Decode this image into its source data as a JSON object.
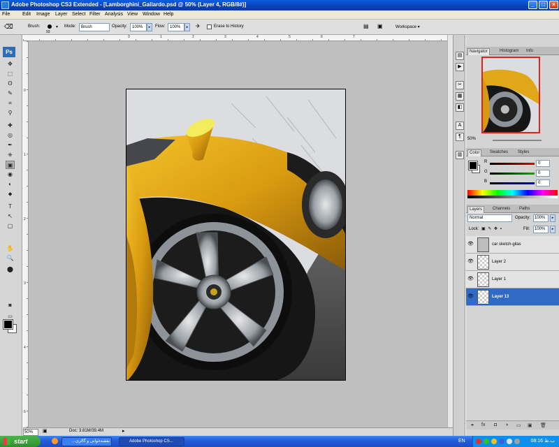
{
  "window": {
    "title": "Adobe Photoshop CS3 Extended - [Lamborghini_Gallardo.psd @ 50% (Layer 4, RGB/8#)]",
    "minimize": "_",
    "maximize": "□",
    "close": "×"
  },
  "menu": [
    "File",
    "Edit",
    "Image",
    "Layer",
    "Select",
    "Filter",
    "Analysis",
    "View",
    "Window",
    "Help"
  ],
  "options": {
    "brush_label": "Brush:",
    "brush_size": "93",
    "mode_label": "Mode:",
    "mode_value": "Brush",
    "opacity_label": "Opacity:",
    "opacity_value": "100%",
    "flow_label": "Flow:",
    "flow_value": "100%",
    "erase_history": "Erase to History",
    "workspace": "Workspace ▾"
  },
  "toolbox": {
    "logo": "Ps",
    "tools": [
      "✥",
      "⬚",
      "ʘ",
      "✎",
      "⌗",
      "⚲",
      "✚",
      "◎",
      "✒",
      "⎈",
      "▣",
      "◉",
      "◐",
      "⬥",
      "T",
      "↖",
      "▢",
      "✋",
      "🔍",
      "⬤"
    ]
  },
  "rulers": {
    "top": [
      "0",
      "1",
      "2",
      "3",
      "4",
      "5",
      "6",
      "7"
    ],
    "left": [
      "0",
      "1",
      "2",
      "3",
      "4",
      "5"
    ]
  },
  "status": {
    "zoom": "50%",
    "doc": "Doc: 3.81M/39.4M"
  },
  "navigator": {
    "tabs": [
      "Navigator",
      "Histogram",
      "Info"
    ],
    "zoom": "50%"
  },
  "color_panel": {
    "tabs": [
      "Color",
      "Swatches",
      "Styles"
    ],
    "channels": [
      {
        "label": "R",
        "value": "0",
        "color": "#e00000"
      },
      {
        "label": "G",
        "value": "0",
        "color": "#00b000"
      },
      {
        "label": "B",
        "value": "0",
        "color": "#0000e0"
      }
    ]
  },
  "layers_panel": {
    "tabs": [
      "Layers",
      "Channels",
      "Paths"
    ],
    "blend_mode": "Normal",
    "opacity_label": "Opacity:",
    "opacity_value": "100%",
    "lock_label": "Lock:",
    "lock_icons": "▣ ✎ ✥ ▪",
    "fill_label": "Fill:",
    "fill_value": "100%",
    "layers": [
      {
        "name": "car sketch-gilas",
        "selected": false
      },
      {
        "name": "Layer 2",
        "selected": false
      },
      {
        "name": "Layer 1",
        "selected": false
      },
      {
        "name": "Layer 13",
        "selected": true
      }
    ]
  },
  "taskbar": {
    "start": "start",
    "tasks": [
      {
        "label": "...نقشه‌خوانی و گالری - ",
        "active": false
      },
      {
        "label": "Adobe Photoshop CS...",
        "active": true
      }
    ],
    "lang": "EN",
    "clock": "08:16 ب.ظ"
  }
}
